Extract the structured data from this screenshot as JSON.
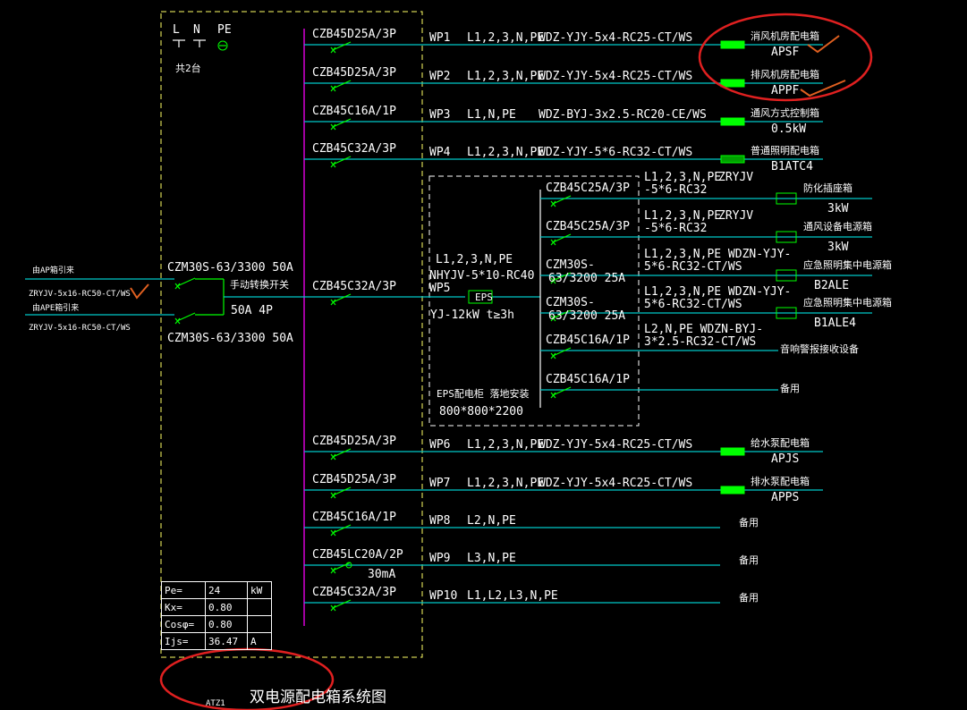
{
  "header": {
    "L": "L",
    "N": "N",
    "PE": "PE",
    "count": "共2台"
  },
  "incoming": {
    "ap_label": "由AP箱引来",
    "ap_cable": "ZRYJV-5x16-RC50-CT/WS",
    "ape_label": "由APE箱引来",
    "ape_cable": "ZRYJV-5x16-RC50-CT/WS",
    "breaker_top": "CZM30S-63/3300 50A",
    "breaker_bottom": "CZM30S-63/3300 50A",
    "switch_name": "手动转换开关",
    "switch_rating": "50A 4P"
  },
  "circuits": [
    {
      "breaker": "CZB45D25A/3P",
      "id": "WP1",
      "phases": "L1,2,3,N,PE",
      "cable": "WDZ-YJY-5x4-RC25-CT/WS",
      "load": "消风机房配电箱",
      "tag": "APSF"
    },
    {
      "breaker": "CZB45D25A/3P",
      "id": "WP2",
      "phases": "L1,2,3,N,PE",
      "cable": "WDZ-YJY-5x4-RC25-CT/WS",
      "load": "排风机房配电箱",
      "tag": "APPF"
    },
    {
      "breaker": "CZB45C16A/1P",
      "id": "WP3",
      "phases": "L1,N,PE",
      "cable": "WDZ-BYJ-3x2.5-RC20-CE/WS",
      "load": "通风方式控制箱",
      "tag": "0.5kW"
    },
    {
      "breaker": "CZB45C32A/3P",
      "id": "WP4",
      "phases": "L1,2,3,N,PE",
      "cable": "WDZ-YJY-5*6-RC32-CT/WS",
      "load": "普通照明配电箱",
      "tag": "B1ATC4"
    },
    {
      "breaker": "CZB45C32A/3P",
      "id": "WP5",
      "phases": "",
      "cable": "",
      "load": "",
      "tag": ""
    },
    {
      "breaker": "CZB45D25A/3P",
      "id": "WP6",
      "phases": "L1,2,3,N,PE",
      "cable": "WDZ-YJY-5x4-RC25-CT/WS",
      "load": "给水泵配电箱",
      "tag": "APJS"
    },
    {
      "breaker": "CZB45D25A/3P",
      "id": "WP7",
      "phases": "L1,2,3,N,PE",
      "cable": "WDZ-YJY-5x4-RC25-CT/WS",
      "load": "排水泵配电箱",
      "tag": "APPS"
    },
    {
      "breaker": "CZB45C16A/1P",
      "id": "WP8",
      "phases": "L2,N,PE",
      "cable": "",
      "load": "备用",
      "tag": ""
    },
    {
      "breaker": "CZB45LC20A/2P",
      "id": "WP9",
      "phases": "L3,N,PE",
      "cable": "",
      "load": "备用",
      "tag": ""
    },
    {
      "breaker": "CZB45C32A/3P",
      "id": "WP10",
      "phases": "L1,L2,L3,N,PE",
      "cable": "",
      "load": "备用",
      "tag": ""
    }
  ],
  "rcd_rating": "30mA",
  "eps": {
    "feed_phases": "L1,2,3,N,PE",
    "feed_cable": "NHYJV-5*10-RC40",
    "feed_id": "WP5",
    "unit": "EPS",
    "spec": "YJ-12kW  t≥3h",
    "title": "EPS配电柜 落地安装",
    "size": "800*800*2200",
    "sub": [
      {
        "breaker": "CZB45C25A/3P",
        "cable1": "L1,2,3,N,PE",
        "cable2": "-5*6-RC32",
        "extra": "ZRYJV",
        "load": "防化插座箱",
        "tag": "3kW"
      },
      {
        "breaker": "CZB45C25A/3P",
        "cable1": "L1,2,3,N,PE",
        "cable2": "-5*6-RC32",
        "extra": "ZRYJV",
        "load": "通风设备电源箱",
        "tag": "3kW"
      },
      {
        "breaker": "CZM30S-",
        "breaker2": "63/3200 25A",
        "cable1": "L1,2,3,N,PE WDZN-YJY-",
        "cable2": "5*6-RC32-CT/WS",
        "extra": "",
        "load": "应急照明集中电源箱",
        "tag": "B2ALE"
      },
      {
        "breaker": "CZM30S-",
        "breaker2": "63/3200 25A",
        "cable1": "L1,2,3,N,PE WDZN-YJY-",
        "cable2": "5*6-RC32-CT/WS",
        "extra": "",
        "load": "应急照明集中电源箱",
        "tag": "B1ALE4"
      },
      {
        "breaker": "CZB45C16A/1P",
        "cable1": "L2,N,PE WDZN-BYJ-",
        "cable2": "3*2.5-RC32-CT/WS",
        "extra": "",
        "load": "音响警报接收设备",
        "tag": ""
      },
      {
        "breaker": "CZB45C16A/1P",
        "cable1": "",
        "cable2": "",
        "extra": "",
        "load": "备用",
        "tag": ""
      }
    ]
  },
  "calc_table": {
    "rows": [
      {
        "label": "Pe=",
        "value": "24",
        "unit": "kW"
      },
      {
        "label": "Kx=",
        "value": "0.80",
        "unit": ""
      },
      {
        "label": "Cosφ=",
        "value": "0.80",
        "unit": ""
      },
      {
        "label": "Ijs=",
        "value": "36.47",
        "unit": "A"
      }
    ]
  },
  "footer": {
    "prefix": "ATZ1",
    "title": "双电源配电箱系统图"
  },
  "colors": {
    "background": "#000000",
    "bus": "#c800c8",
    "feeder": "#00c8c8",
    "breaker": "#00ff00",
    "box": "#ffff66",
    "markup": "#e02020",
    "check": "#e06020",
    "text": "#ffffff"
  }
}
